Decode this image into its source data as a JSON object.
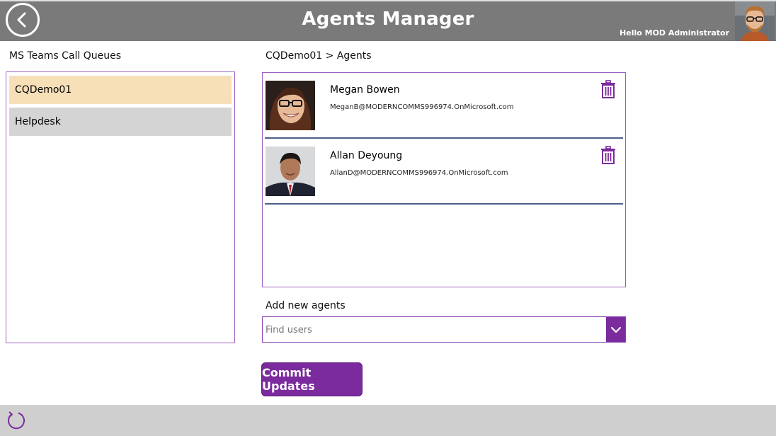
{
  "header": {
    "title": "Agents Manager",
    "greeting": "Hello MOD Administrator"
  },
  "left_panel": {
    "label": "MS Teams Call Queues",
    "queues": [
      {
        "label": "CQDemo01",
        "selected": true
      },
      {
        "label": "Helpdesk",
        "selected": false
      }
    ]
  },
  "right_panel": {
    "label": "CQDemo01 > Agents",
    "agents": [
      {
        "name": "Megan Bowen",
        "email": "MeganB@MODERNCOMMS996974.OnMicrosoft.com"
      },
      {
        "name": "Allan Deyoung",
        "email": "AllanD@MODERNCOMMS996974.OnMicrosoft.com"
      }
    ],
    "add_label": "Add new agents",
    "search_placeholder": "Find users",
    "commit_label": "Commit Updates"
  },
  "colors": {
    "header_bg": "#7a7a7a",
    "accent_purple": "#7b2b9d",
    "selected_item": "#f7dfb8",
    "unselected_item": "#d4d4d4",
    "footer_bg": "#cfcfcf"
  },
  "icons": [
    "back-arrow-icon",
    "trash-icon",
    "chevron-down-icon",
    "refresh-icon"
  ]
}
